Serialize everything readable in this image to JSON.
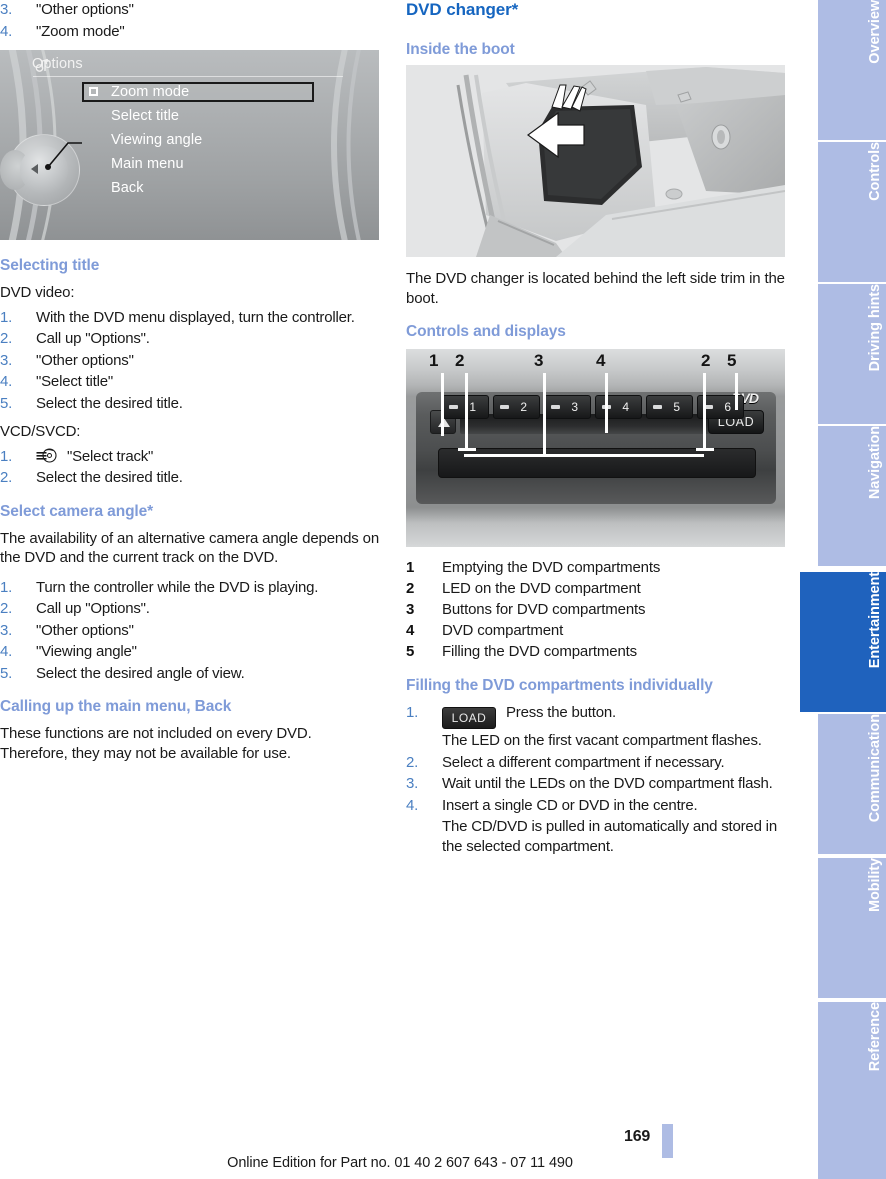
{
  "left_column": {
    "continued_steps": [
      {
        "num": "3.",
        "text": "\"Other options\""
      },
      {
        "num": "4.",
        "text": "\"Zoom mode\""
      }
    ],
    "idrive_screen": {
      "header": "Options",
      "header_icon": "media-options-icon",
      "menu_items": [
        {
          "label": "Zoom mode",
          "selected": true,
          "checkbox": true
        },
        {
          "label": "Select title",
          "selected": false,
          "checkbox": false
        },
        {
          "label": "Viewing angle",
          "selected": false,
          "checkbox": false
        },
        {
          "label": "Main menu",
          "selected": false,
          "checkbox": false
        },
        {
          "label": "Back",
          "selected": false,
          "checkbox": false
        }
      ]
    },
    "selecting_title": {
      "heading": "Selecting title",
      "intro": "DVD video:",
      "steps": [
        {
          "num": "1.",
          "text": "With the DVD menu displayed, turn the controller."
        },
        {
          "num": "2.",
          "text": "Call up \"Options\"."
        },
        {
          "num": "3.",
          "text": "\"Other options\""
        },
        {
          "num": "4.",
          "text": "\"Select title\""
        },
        {
          "num": "5.",
          "text": "Select the desired title."
        }
      ],
      "intro2": "VCD/SVCD:",
      "steps2": [
        {
          "num": "1.",
          "icon": "select-track-icon",
          "text": "\"Select track\""
        },
        {
          "num": "2.",
          "text": "Select the desired title."
        }
      ]
    },
    "select_camera_angle": {
      "heading": "Select camera angle*",
      "body": "The availability of an alternative camera angle depends on the DVD and the current track on the DVD.",
      "steps": [
        {
          "num": "1.",
          "text": "Turn the controller while the DVD is playing."
        },
        {
          "num": "2.",
          "text": "Call up \"Options\"."
        },
        {
          "num": "3.",
          "text": "\"Other options\""
        },
        {
          "num": "4.",
          "text": "\"Viewing angle\""
        },
        {
          "num": "5.",
          "text": "Select the desired angle of view."
        }
      ]
    },
    "main_menu_back": {
      "heading": "Calling up the main menu, Back",
      "body": "These functions are not included on every DVD. Therefore, they may not be available for use."
    }
  },
  "right_column": {
    "chapter_heading": "DVD changer*",
    "inside_boot": {
      "heading": "Inside the boot",
      "caption": "The DVD changer is located behind the left side trim in the boot."
    },
    "controls_displays": {
      "heading": "Controls and displays",
      "diagram": {
        "callouts_top": [
          "1",
          "2",
          "3",
          "4",
          "2",
          "5"
        ],
        "compartment_buttons": [
          "1",
          "2",
          "3",
          "4",
          "5",
          "6"
        ],
        "eject_button_icon": "eject-triangle-icon",
        "load_button_label": "LOAD",
        "dvd_logo": "DVD"
      },
      "legend": [
        {
          "num": "1",
          "text": "Emptying the DVD compartments"
        },
        {
          "num": "2",
          "text": "LED on the DVD compartment"
        },
        {
          "num": "3",
          "text": "Buttons for DVD compartments"
        },
        {
          "num": "4",
          "text": "DVD compartment"
        },
        {
          "num": "5",
          "text": "Filling the DVD compartments"
        }
      ]
    },
    "filling_individually": {
      "heading": "Filling the DVD compartments individually",
      "steps": [
        {
          "num": "1.",
          "button": "LOAD",
          "text": "Press the button.",
          "sub": "The LED on the first vacant compartment flashes."
        },
        {
          "num": "2.",
          "text": "Select a different compartment if necessary."
        },
        {
          "num": "3.",
          "text": "Wait until the LEDs on the DVD compartment flash."
        },
        {
          "num": "4.",
          "text": "Insert a single CD or DVD in the centre.",
          "sub": "The CD/DVD is pulled in automatically and stored in the selected compartment."
        }
      ]
    }
  },
  "sidebar": {
    "tabs": [
      {
        "label": "Overview",
        "active": false
      },
      {
        "label": "Controls",
        "active": false
      },
      {
        "label": "Driving hints",
        "active": false
      },
      {
        "label": "Navigation",
        "active": false
      },
      {
        "label": "Entertainment",
        "active": true
      },
      {
        "label": "Communication",
        "active": false
      },
      {
        "label": "Mobility",
        "active": false
      },
      {
        "label": "Reference",
        "active": false
      }
    ]
  },
  "footer": {
    "page_number": "169",
    "edition": "Online Edition for Part no. 01 40 2 607 643 - 07 11 490"
  },
  "colors": {
    "chapter_heading": "#1565c0",
    "section_heading": "#7f9bd8",
    "step_number": "#4a7fc1",
    "tab_inactive": "#aebce4",
    "tab_active": "#1f62bd",
    "body_text": "#1a1a1a"
  }
}
